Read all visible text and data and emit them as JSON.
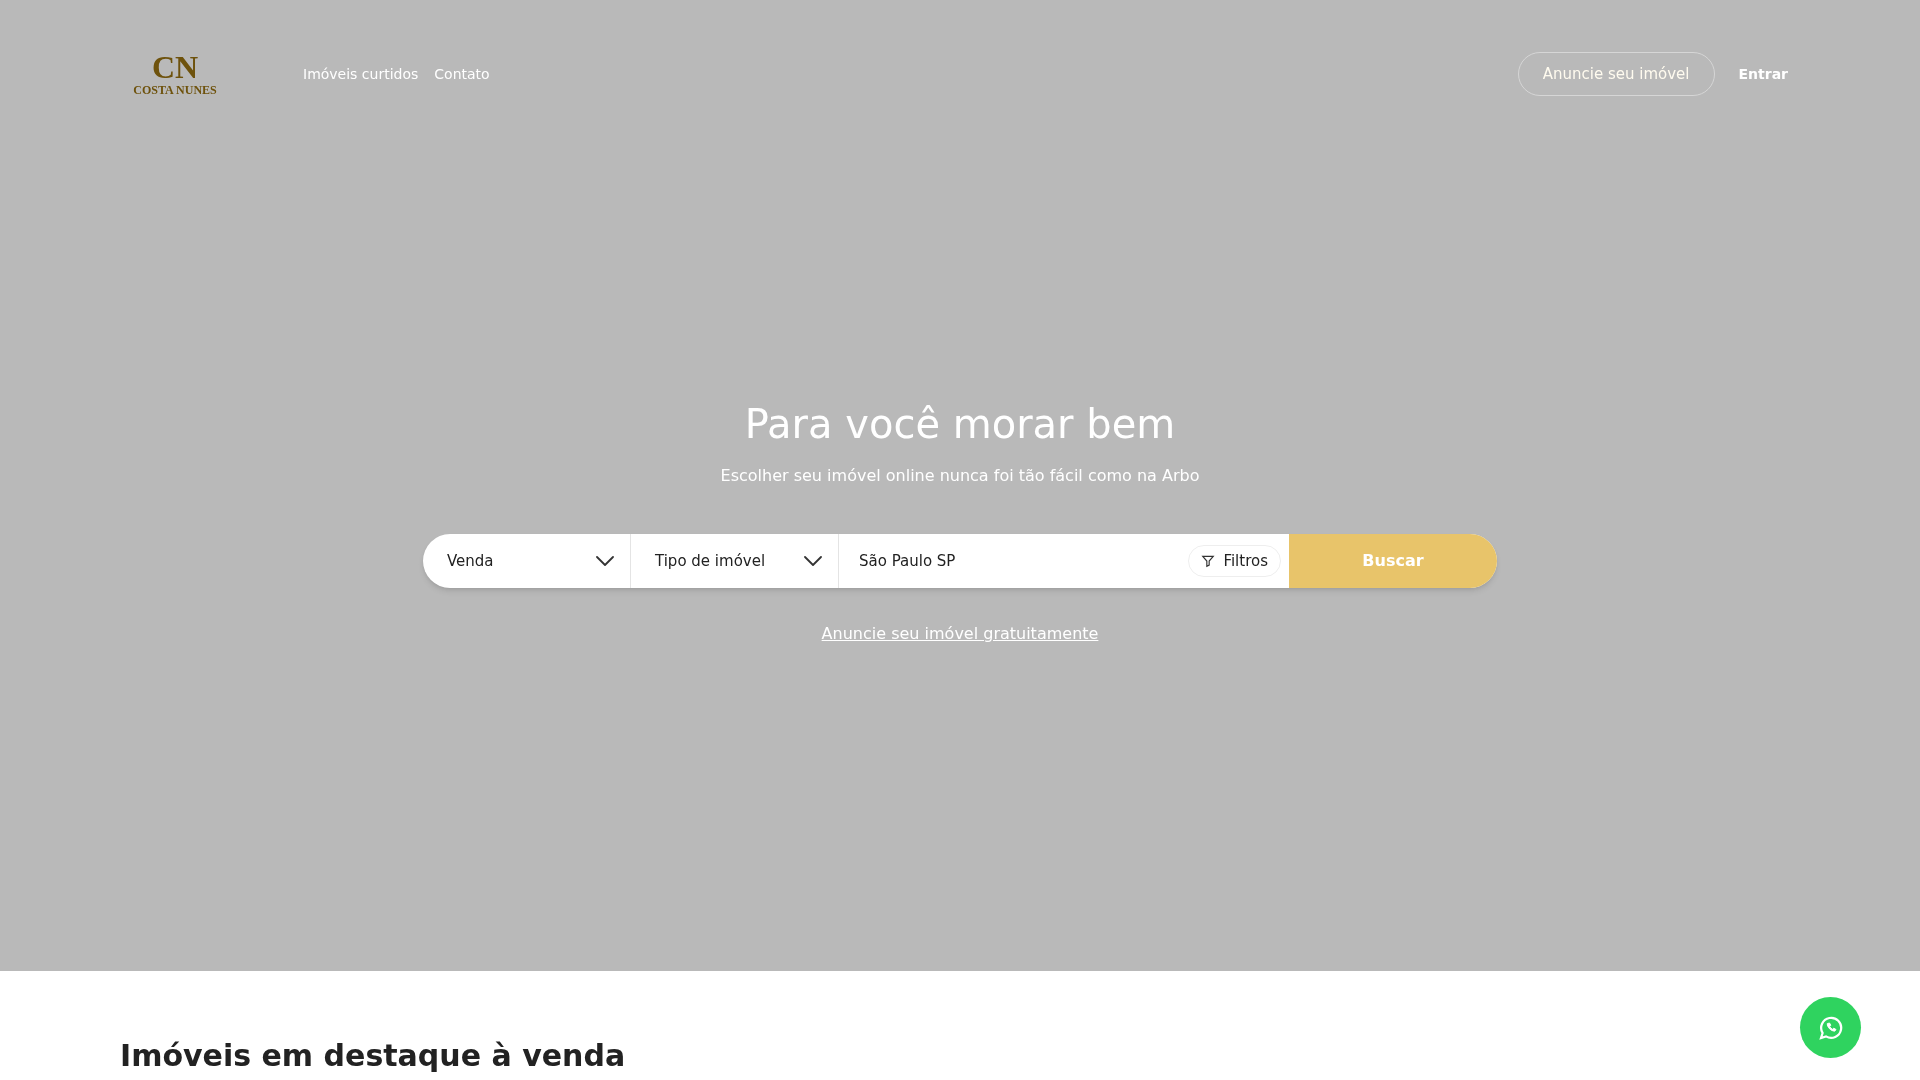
{
  "header": {
    "logo": {
      "monogram": "CN",
      "name": "COSTA NUNES"
    },
    "nav": [
      "Imóveis curtidos",
      "Contato"
    ],
    "advertise_button": "Anuncie seu imóvel",
    "login": "Entrar"
  },
  "hero": {
    "title": "Para você morar bem",
    "subtitle": "Escolher seu imóvel online nunca foi tão fácil como na Arbo",
    "search": {
      "deal_select": "Venda",
      "type_select": "Tipo de imóvel",
      "location": {
        "value": "São Paulo SP"
      },
      "filters_button": "Filtros",
      "submit": "Buscar"
    },
    "link": "Anuncie seu imóvel gratuitamente"
  },
  "featured": {
    "title": "Imóveis em destaque à venda"
  }
}
